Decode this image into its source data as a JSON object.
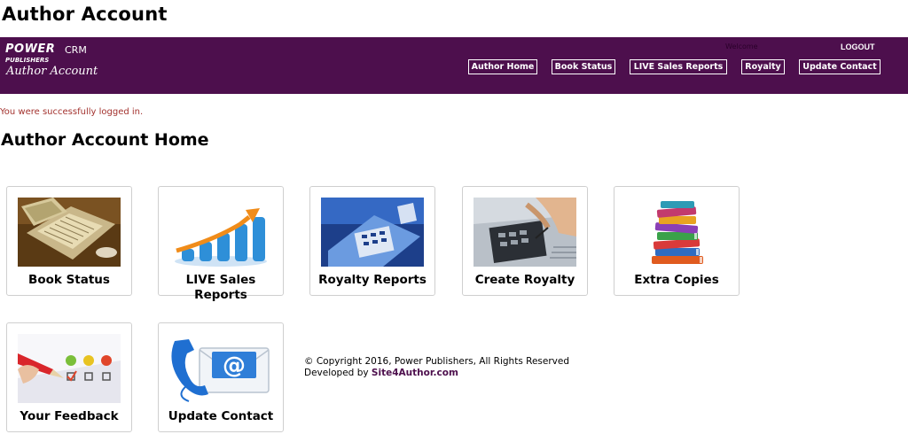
{
  "page_title": "Author Account",
  "header": {
    "logo_power": "POWER",
    "logo_crm": "CRM",
    "logo_publishers": "PUBLISHERS",
    "logo_sub": "Author Account",
    "welcome": "Welcome",
    "logout_label": "LOGOUT",
    "nav": [
      "Author Home",
      "Book Status",
      "LIVE Sales Reports",
      "Royalty",
      "Update Contact"
    ],
    "background_color": "#4d0f4d"
  },
  "message": "You were successfully logged in.",
  "section_title": "Author Account Home",
  "tiles": [
    {
      "label": "Book Status",
      "icon": "laptop-icon"
    },
    {
      "label": "LIVE Sales Reports",
      "icon": "bar-growth-icon"
    },
    {
      "label": "Royalty Reports",
      "icon": "report-calculator-icon"
    },
    {
      "label": "Create Royalty",
      "icon": "calculator-hand-icon"
    },
    {
      "label": "Extra Copies",
      "icon": "book-stack-icon"
    },
    {
      "label": "Your Feedback",
      "icon": "feedback-checklist-icon"
    },
    {
      "label": "Update Contact",
      "icon": "phone-email-icon"
    }
  ],
  "footer": {
    "copyright": "© Copyright 2016, Power Publishers, All Rights Reserved",
    "developed_by": "Developed by",
    "developer": "Site4Author.com"
  }
}
